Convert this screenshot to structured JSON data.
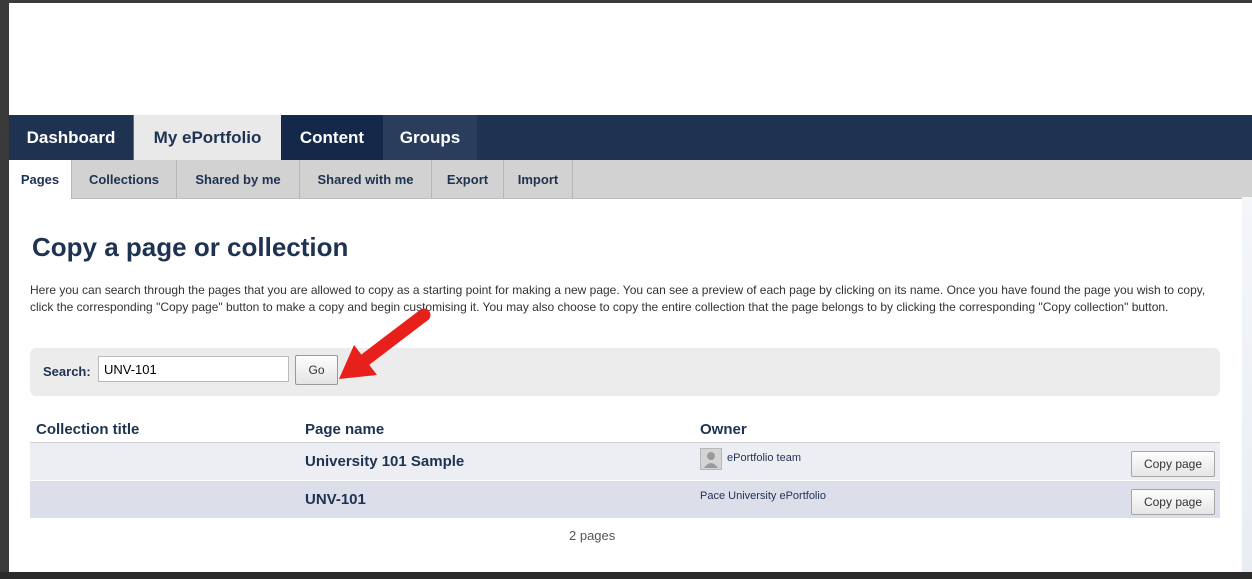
{
  "nav": {
    "tabs": [
      {
        "label": "Dashboard"
      },
      {
        "label": "My ePortfolio"
      },
      {
        "label": "Content"
      },
      {
        "label": "Groups"
      }
    ],
    "active_tab": "My ePortfolio"
  },
  "subnav": {
    "items": [
      {
        "label": "Pages"
      },
      {
        "label": "Collections"
      },
      {
        "label": "Shared by me"
      },
      {
        "label": "Shared with me"
      },
      {
        "label": "Export"
      },
      {
        "label": "Import"
      }
    ],
    "active_item": "Pages"
  },
  "page": {
    "title": "Copy a page or collection",
    "description": "Here you can search through the pages that you are allowed to copy as a starting point for making a new page. You can see a preview of each page by clicking on its name. Once you have found the page you wish to copy, click the corresponding \"Copy page\" button to make a copy and begin customising it. You may also choose to copy the entire collection that the page belongs to by clicking the corresponding \"Copy collection\" button."
  },
  "search": {
    "label": "Search:",
    "value": "UNV-101",
    "go_label": "Go"
  },
  "table": {
    "headers": [
      "Collection title",
      "Page name",
      "Owner"
    ],
    "rows": [
      {
        "collection": "",
        "page": "University 101 Sample",
        "owner": "ePortfolio team",
        "action": "Copy page"
      },
      {
        "collection": "",
        "page": "UNV-101",
        "owner": "Pace University ePortfolio",
        "action": "Copy page"
      }
    ],
    "count": "2 pages"
  },
  "colors": {
    "nav_bg": "#1e3251",
    "accent_text": "#1e3251",
    "annotation_arrow": "#e8201c"
  }
}
